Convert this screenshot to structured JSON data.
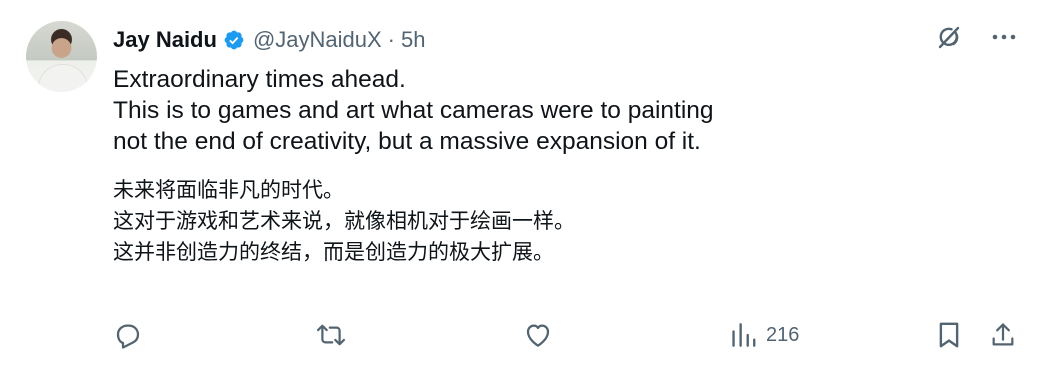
{
  "tweet": {
    "author_name": "Jay Naidu",
    "handle": "@JayNaiduX",
    "separator": "·",
    "time": "5h",
    "english_lines": [
      "Extraordinary times ahead.",
      "This is to games and art what cameras were to painting",
      "not the end of creativity, but a massive expansion of it."
    ],
    "chinese_lines": [
      "未来将面临非凡的时代。",
      "这对于游戏和艺术来说，就像相机对于绘画一样。",
      "这并非创造力的终结，而是创造力的极大扩展。"
    ]
  },
  "actions": {
    "views_count": "216"
  },
  "colors": {
    "verified": "#1d9bf0",
    "muted": "#536471",
    "text": "#0f1419"
  },
  "icons": {
    "verified": "verified-badge-icon",
    "grok": "grok-icon",
    "more": "more-icon",
    "reply": "reply-icon",
    "repost": "repost-icon",
    "like": "like-icon",
    "views": "views-icon",
    "bookmark": "bookmark-icon",
    "share": "share-icon"
  }
}
